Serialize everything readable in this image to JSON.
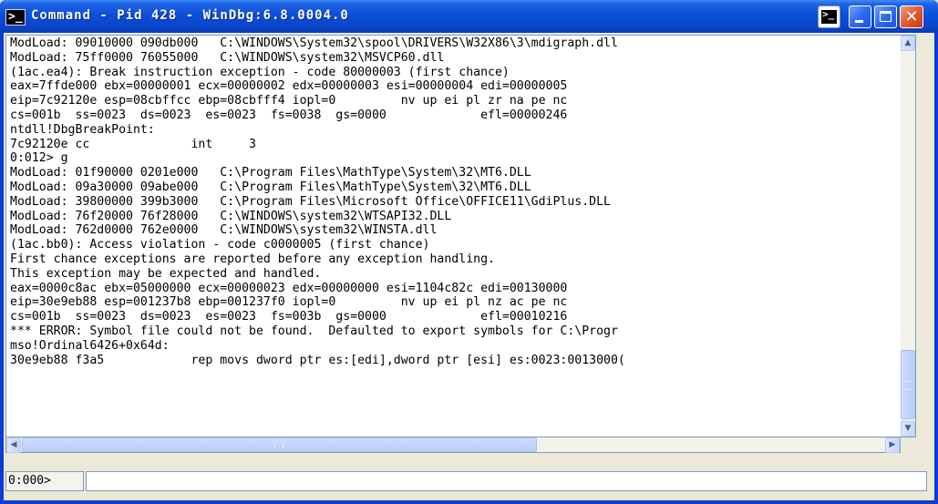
{
  "window": {
    "title": "Command - Pid 428 - WinDbg:6.8.0004.0",
    "app_icon": "command-prompt-icon"
  },
  "output": {
    "lines": [
      "ModLoad: 09010000 090db000   C:\\WINDOWS\\System32\\spool\\DRIVERS\\W32X86\\3\\mdigraph.dll",
      "ModLoad: 75ff0000 76055000   C:\\WINDOWS\\system32\\MSVCP60.dll",
      "(1ac.ea4): Break instruction exception - code 80000003 (first chance)",
      "eax=7ffde000 ebx=00000001 ecx=00000002 edx=00000003 esi=00000004 edi=00000005",
      "eip=7c92120e esp=08cbffcc ebp=08cbfff4 iopl=0         nv up ei pl zr na pe nc",
      "cs=001b  ss=0023  ds=0023  es=0023  fs=0038  gs=0000             efl=00000246",
      "ntdll!DbgBreakPoint:",
      "7c92120e cc              int     3",
      "0:012> g",
      "ModLoad: 01f90000 0201e000   C:\\Program Files\\MathType\\System\\32\\MT6.DLL",
      "ModLoad: 09a30000 09abe000   C:\\Program Files\\MathType\\System\\32\\MT6.DLL",
      "ModLoad: 39800000 399b3000   C:\\Program Files\\Microsoft Office\\OFFICE11\\GdiPlus.DLL",
      "ModLoad: 76f20000 76f28000   C:\\WINDOWS\\system32\\WTSAPI32.DLL",
      "ModLoad: 762d0000 762e0000   C:\\WINDOWS\\system32\\WINSTA.dll",
      "(1ac.bb0): Access violation - code c0000005 (first chance)",
      "First chance exceptions are reported before any exception handling.",
      "This exception may be expected and handled.",
      "eax=0000c8ac ebx=05000000 ecx=00000023 edx=00000000 esi=1104c82c edi=00130000",
      "eip=30e9eb88 esp=001237b8 ebp=001237f0 iopl=0         nv up ei pl nz ac pe nc",
      "cs=001b  ss=0023  ds=0023  es=0023  fs=003b  gs=0000             efl=00010216",
      "*** ERROR: Symbol file could not be found.  Defaulted to export symbols for C:\\Progr",
      "mso!Ordinal6426+0x64d:",
      "30e9eb88 f3a5            rep movs dword ptr es:[edi],dword ptr [esi] es:0023:0013000("
    ]
  },
  "command": {
    "prompt": "0:000>",
    "value": ""
  }
}
